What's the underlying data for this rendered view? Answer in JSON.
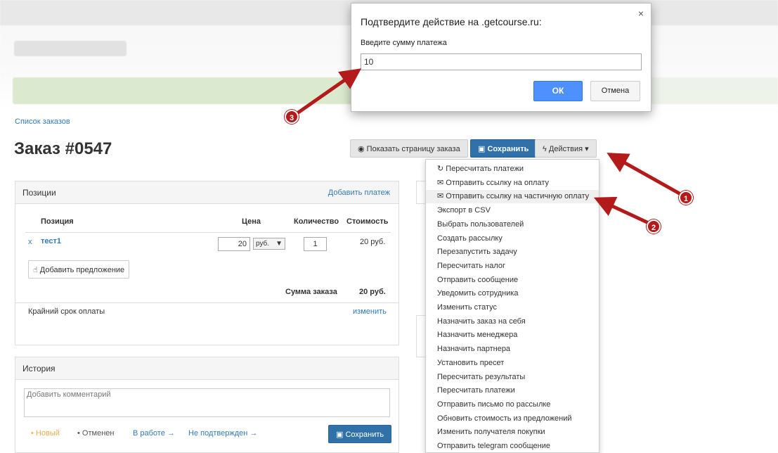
{
  "header": {
    "breadcrumb": "Список заказов",
    "title": "Заказ #0547"
  },
  "toolbar": {
    "show_icon": "eye-icon",
    "show_label": "Показать страницу заказа",
    "save_icon": "floppy-icon",
    "save_label": "Сохранить",
    "actions_icon": "bolt-icon",
    "actions_label": "Действия"
  },
  "positions": {
    "title": "Позиции",
    "add_payment": "Добавить платеж",
    "col_position": "Позиция",
    "col_price": "Цена",
    "col_qty": "Количество",
    "col_cost": "Стоимость",
    "rows": [
      {
        "remove": "x",
        "name": "тест1",
        "price": "20",
        "currency": "руб.",
        "qty": "1",
        "cost": "20 руб."
      }
    ],
    "add_offer": "Добавить предложение",
    "total_label": "Сумма заказа",
    "total_value": "20 руб.",
    "deadline_label": "Крайний срок оплаты",
    "deadline_edit": "изменить"
  },
  "history": {
    "title": "История",
    "comment_placeholder": "Добавить комментарий",
    "statuses": [
      "Новый",
      "Отменен",
      "В работе",
      "Не подтвержден"
    ],
    "save_label": "Сохранить"
  },
  "actions_menu": [
    "Пересчитать платежи",
    "Отправить ссылку на оплату",
    "Отправить ссылку на частичную оплату",
    "Экспорт в CSV",
    "Выбрать пользователей",
    "Создать рассылку",
    "Перезапустить задачу",
    "Пересчитать налог",
    "Отправить сообщение",
    "Уведомить сотрудника",
    "Изменить статус",
    "Назначить заказ на себя",
    "Назначить менеджера",
    "Назначить партнера",
    "Установить пресет",
    "Пересчитать результаты",
    "Пересчитать платежи",
    "Отправить письмо по рассылке",
    "Обновить стоимость из предложений",
    "Изменить получателя покупки",
    "Отправить telegram сообщение"
  ],
  "dialog": {
    "title": "Подтвердите действие на .getcourse.ru:",
    "prompt": "Введите сумму платежа",
    "value": "10",
    "ok": "ОК",
    "cancel": "Отмена",
    "close": "×"
  },
  "annotations": {
    "m1": "1",
    "m2": "2",
    "m3": "3",
    "color": "#b31b1b"
  }
}
